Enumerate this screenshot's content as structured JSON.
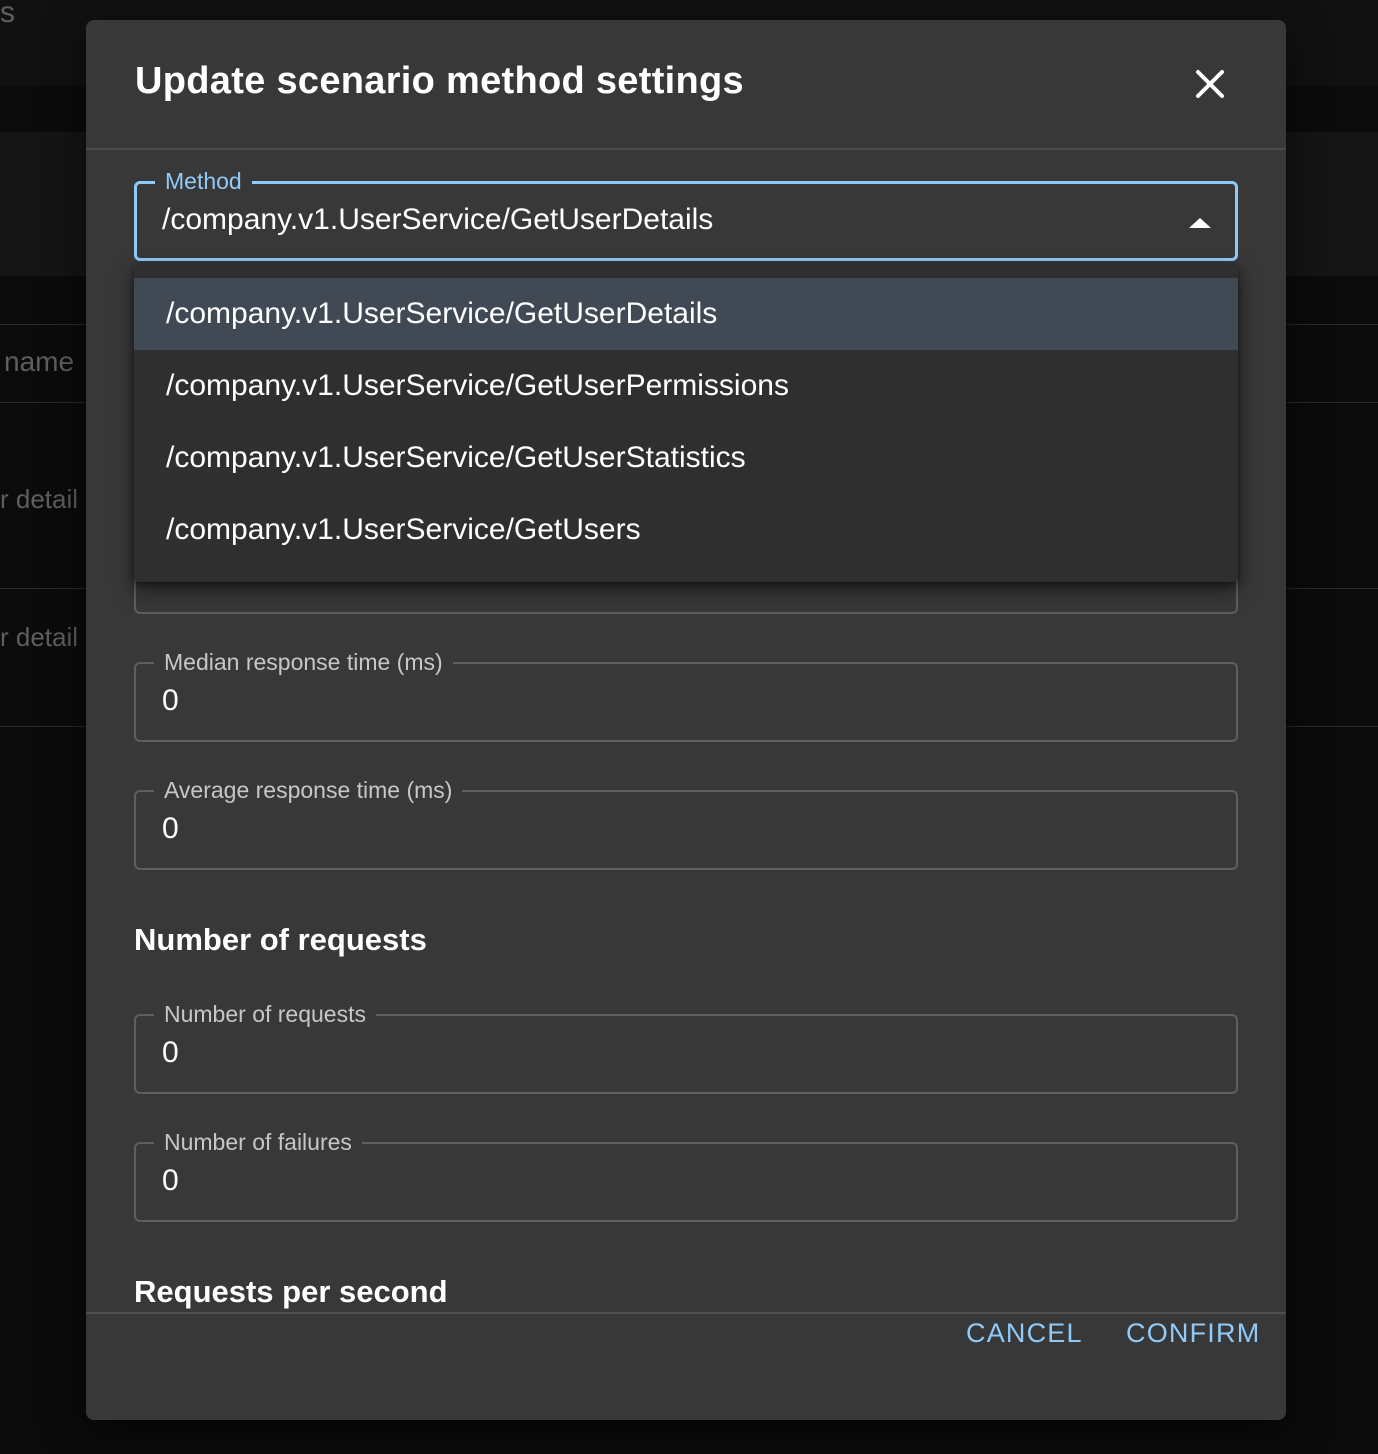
{
  "background": {
    "top_letter": "s",
    "column_header": "name",
    "row_texts": [
      "r detail",
      "r detail"
    ]
  },
  "dialog": {
    "title": "Update scenario method settings",
    "close_icon": "close-icon"
  },
  "method_field": {
    "label": "Method",
    "value": "/company.v1.UserService/GetUserDetails",
    "options": [
      "/company.v1.UserService/GetUserDetails",
      "/company.v1.UserService/GetUserPermissions",
      "/company.v1.UserService/GetUserStatistics",
      "/company.v1.UserService/GetUsers"
    ],
    "selected_index": 0
  },
  "fields": {
    "median": {
      "label": "Median response time (ms)",
      "value": "0"
    },
    "average": {
      "label": "Average response time (ms)",
      "value": "0"
    },
    "num_requests": {
      "label": "Number of requests",
      "value": "0"
    },
    "num_failures": {
      "label": "Number of failures",
      "value": "0"
    }
  },
  "sections": {
    "requests": "Number of requests",
    "rps": "Requests per second"
  },
  "actions": {
    "cancel": "CANCEL",
    "confirm": "CONFIRM"
  },
  "colors": {
    "accent": "#90caf9",
    "dialog_bg": "#383838",
    "menu_bg": "#2f2f2f",
    "selected_item_bg": "#414a54"
  }
}
